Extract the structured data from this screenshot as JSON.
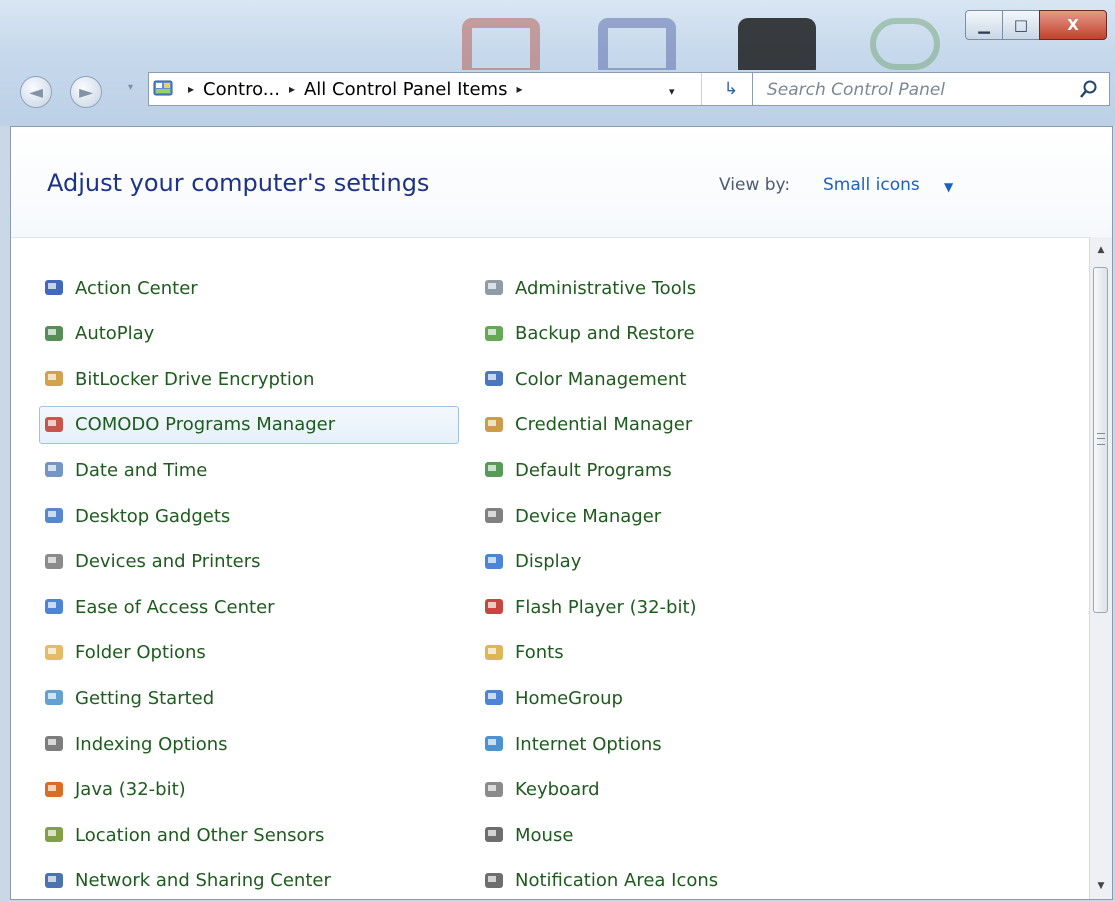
{
  "window": {
    "controls": {
      "minimize": "▁",
      "maximize": "□",
      "close": "X"
    }
  },
  "nav": {
    "back_icon": "back-arrow-icon",
    "forward_icon": "forward-arrow-icon",
    "history_dropdown": "▾"
  },
  "address": {
    "crumbs": [
      "Contro...",
      "All Control Panel Items"
    ],
    "separator": "▸",
    "dropdown_arrow": "▾",
    "refresh_glyph": "↳"
  },
  "search": {
    "placeholder": "Search Control Panel"
  },
  "header": {
    "title": "Adjust your computer's settings",
    "view_by_label": "View by:",
    "view_by_value": "Small icons",
    "view_by_arrow": "▼"
  },
  "items_left": [
    {
      "label": "Action Center",
      "icon": "flag-icon",
      "color": "#1f4fb3"
    },
    {
      "label": "AutoPlay",
      "icon": "autoplay-icon",
      "color": "#3a7a3a"
    },
    {
      "label": "BitLocker Drive Encryption",
      "icon": "bitlocker-key-icon",
      "color": "#c9932b"
    },
    {
      "label": "COMODO Programs Manager",
      "icon": "comodo-icon",
      "color": "#c0392b"
    },
    {
      "label": "Date and Time",
      "icon": "clock-calendar-icon",
      "color": "#5b84b8"
    },
    {
      "label": "Desktop Gadgets",
      "icon": "gadgets-icon",
      "color": "#3a73c7"
    },
    {
      "label": "Devices and Printers",
      "icon": "printer-icon",
      "color": "#777777"
    },
    {
      "label": "Ease of Access Center",
      "icon": "ease-of-access-icon",
      "color": "#2f6fd1"
    },
    {
      "label": "Folder Options",
      "icon": "folder-icon",
      "color": "#e0b04a"
    },
    {
      "label": "Getting Started",
      "icon": "getting-started-icon",
      "color": "#4a90c8"
    },
    {
      "label": "Indexing Options",
      "icon": "indexing-icon",
      "color": "#666666"
    },
    {
      "label": "Java (32-bit)",
      "icon": "java-icon",
      "color": "#d35400"
    },
    {
      "label": "Location and Other Sensors",
      "icon": "sensor-icon",
      "color": "#6b8e23"
    },
    {
      "label": "Network and Sharing Center",
      "icon": "network-icon",
      "color": "#2c5aa0"
    }
  ],
  "items_right": [
    {
      "label": "Administrative Tools",
      "icon": "admin-tools-icon",
      "color": "#7a8a9a"
    },
    {
      "label": "Backup and Restore",
      "icon": "backup-icon",
      "color": "#4a9a3a"
    },
    {
      "label": "Color Management",
      "icon": "color-monitor-icon",
      "color": "#2b5fb3"
    },
    {
      "label": "Credential Manager",
      "icon": "credential-vault-icon",
      "color": "#c68a2c"
    },
    {
      "label": "Default Programs",
      "icon": "default-programs-icon",
      "color": "#3a8a3a"
    },
    {
      "label": "Device Manager",
      "icon": "device-manager-icon",
      "color": "#6a6a6a"
    },
    {
      "label": "Display",
      "icon": "display-icon",
      "color": "#2b6fd1"
    },
    {
      "label": "Flash Player (32-bit)",
      "icon": "flash-icon",
      "color": "#c0261f"
    },
    {
      "label": "Fonts",
      "icon": "fonts-icon",
      "color": "#d8a83a"
    },
    {
      "label": "HomeGroup",
      "icon": "homegroup-icon",
      "color": "#2f6fd1"
    },
    {
      "label": "Internet Options",
      "icon": "internet-options-icon",
      "color": "#2b7fc9"
    },
    {
      "label": "Keyboard",
      "icon": "keyboard-icon",
      "color": "#777777"
    },
    {
      "label": "Mouse",
      "icon": "mouse-icon",
      "color": "#555555"
    },
    {
      "label": "Notification Area Icons",
      "icon": "notification-icon",
      "color": "#555555"
    }
  ],
  "selected_item": "COMODO Programs Manager",
  "scrollbar": {
    "up": "▲",
    "down": "▼",
    "position": 0.0
  }
}
